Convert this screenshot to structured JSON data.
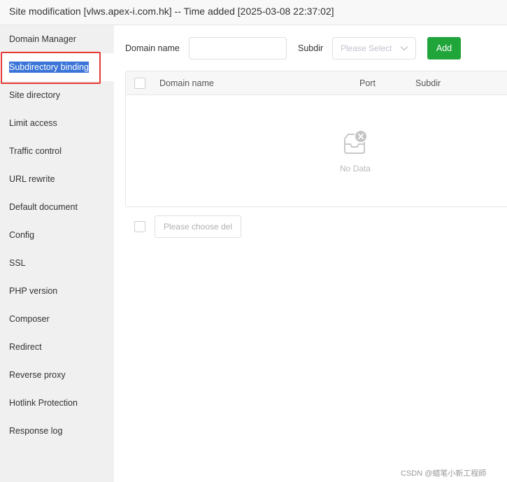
{
  "window": {
    "title": "Site modification [vlws.apex-i.com.hk] -- Time added [2025-03-08 22:37:02]"
  },
  "sidebar": {
    "active_index": 1,
    "items": [
      {
        "label": "Domain Manager"
      },
      {
        "label": "Subdirectory binding"
      },
      {
        "label": "Site directory"
      },
      {
        "label": "Limit access"
      },
      {
        "label": "Traffic control"
      },
      {
        "label": "URL rewrite"
      },
      {
        "label": "Default document"
      },
      {
        "label": "Config"
      },
      {
        "label": "SSL"
      },
      {
        "label": "PHP version"
      },
      {
        "label": "Composer"
      },
      {
        "label": "Redirect"
      },
      {
        "label": "Reverse proxy"
      },
      {
        "label": "Hotlink Protection"
      },
      {
        "label": "Response log"
      }
    ]
  },
  "form": {
    "domain_label": "Domain name",
    "domain_value": "",
    "subdir_label": "Subdir",
    "subdir_placeholder": "Please Select",
    "add_label": "Add"
  },
  "table": {
    "columns": [
      "Domain name",
      "Port",
      "Subdir"
    ],
    "rows": [],
    "empty_text": "No Data"
  },
  "footer": {
    "delete_label": "Please choose del"
  },
  "watermark": "CSDN @蜡笔小新工程師",
  "colors": {
    "accent_green": "#20a53a",
    "selection_blue": "#3a74d8",
    "highlight_red": "#e53935"
  },
  "icons": {
    "empty": "empty-box-icon",
    "select_arrow": "chevron-down-icon"
  }
}
